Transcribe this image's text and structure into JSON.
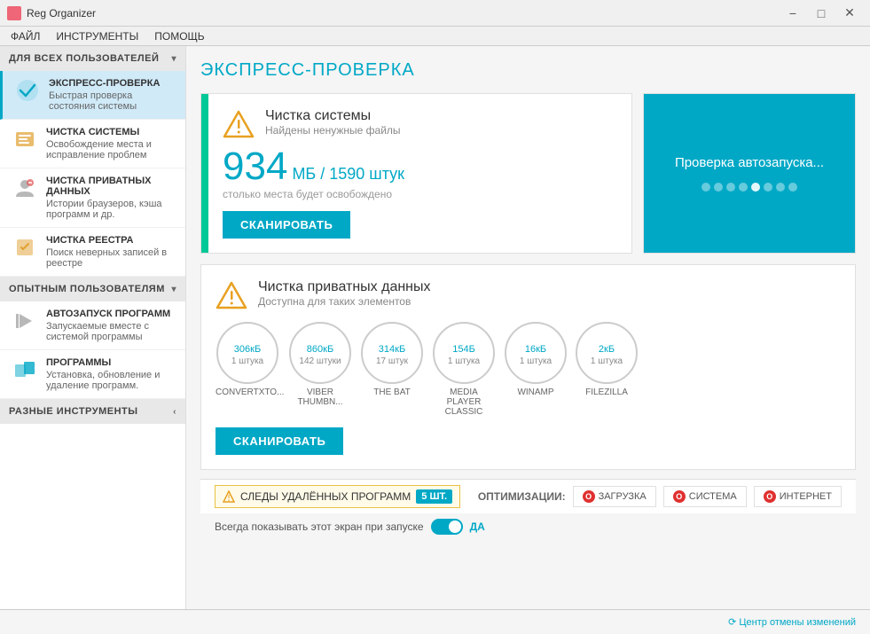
{
  "titlebar": {
    "title": "Reg Organizer",
    "min": "−",
    "max": "□",
    "close": "✕"
  },
  "menubar": {
    "items": [
      "ФАЙЛ",
      "ИНСТРУМЕНТЫ",
      "ПОМОЩЬ"
    ]
  },
  "sidebar": {
    "sections": [
      {
        "id": "all-users",
        "label": "ДЛЯ ВСЕХ ПОЛЬЗОВАТЕЛЕЙ",
        "expanded": true,
        "items": [
          {
            "id": "express",
            "title": "ЭКСПРЕСС-ПРОВЕРКА",
            "desc": "Быстрая проверка состояния системы",
            "active": true
          },
          {
            "id": "system-clean",
            "title": "ЧИСТКА СИСТЕМЫ",
            "desc": "Освобождение места и исправление проблем"
          },
          {
            "id": "private-clean",
            "title": "ЧИСТКА ПРИВАТНЫХ ДАННЫХ",
            "desc": "Истории браузеров, кэша программ и др."
          },
          {
            "id": "registry-clean",
            "title": "ЧИСТКА РЕЕСТРА",
            "desc": "Поиск неверных записей в реестре"
          }
        ]
      },
      {
        "id": "advanced",
        "label": "ОПЫТНЫМ ПОЛЬЗОВАТЕЛЯМ",
        "expanded": true,
        "items": [
          {
            "id": "autorun",
            "title": "АВТОЗАПУСК ПРОГРАММ",
            "desc": "Запускаемые вместе с системой программы"
          },
          {
            "id": "programs",
            "title": "ПРОГРАММЫ",
            "desc": "Установка, обновление и удаление программ."
          }
        ]
      },
      {
        "id": "tools",
        "label": "РАЗНЫЕ ИНСТРУМЕНТЫ",
        "expanded": false,
        "items": []
      }
    ]
  },
  "content": {
    "page_title": "ЭКСПРЕСС-ПРОВЕРКА",
    "system_card": {
      "title": "Чистка системы",
      "subtitle": "Найдены ненужные файлы",
      "size_value": "934",
      "size_unit": "МБ / 1590 штук",
      "size_desc": "столько места будет освобождено",
      "scan_btn": "СКАНИРОВАТЬ"
    },
    "autorun_card": {
      "text": "Проверка автозапуска..."
    },
    "private_card": {
      "title": "Чистка приватных данных",
      "subtitle": "Доступна для таких элементов",
      "scan_btn": "СКАНИРОВАТЬ",
      "apps": [
        {
          "id": "convertxto",
          "size": "306",
          "unit": "кБ",
          "count": "1 штука",
          "name": "CONVERTXTO..."
        },
        {
          "id": "viber",
          "size": "860",
          "unit": "кБ",
          "count": "142 штуки",
          "name": "VIBER THUMBN..."
        },
        {
          "id": "thebat",
          "size": "314",
          "unit": "кБ",
          "count": "17 штук",
          "name": "THE BAT"
        },
        {
          "id": "mpc",
          "size": "154",
          "unit": "Б",
          "count": "1 штука",
          "name": "MEDIA PLAYER CLASSIC"
        },
        {
          "id": "winamp",
          "size": "16",
          "unit": "кБ",
          "count": "1 штука",
          "name": "WINAMP"
        },
        {
          "id": "filezilla",
          "size": "2",
          "unit": "кБ",
          "count": "1 штука",
          "name": "FILEZILLA"
        }
      ]
    }
  },
  "bottom": {
    "deleted_label": "СЛЕДЫ УДАЛЁННЫХ ПРОГРАММ",
    "deleted_count": "5 ШТ.",
    "optimize_label": "ОПТИМИЗАЦИИ:",
    "opt_buttons": [
      "ЗАГРУЗКА",
      "СИСТЕМА",
      "ИНТЕРНЕТ"
    ],
    "toggle_label": "Всегда показывать этот экран при запуске",
    "toggle_state": "ДА"
  },
  "statusbar": {
    "right": "⟳ Центр отмены изменений"
  },
  "dots": [
    false,
    false,
    false,
    false,
    true,
    false,
    false,
    false
  ]
}
